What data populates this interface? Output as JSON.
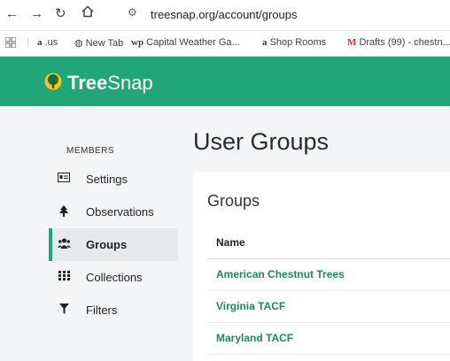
{
  "browser": {
    "url": "treesnap.org/account/groups",
    "bookmarks": [
      {
        "label": ".us",
        "icon": "amazon-icon"
      },
      {
        "label": "New Tab",
        "icon": "globe-icon"
      },
      {
        "label": "Capital Weather Ga...",
        "icon": "washington-post-icon"
      },
      {
        "label": "Shop Rooms",
        "icon": "amazon-icon"
      },
      {
        "label": "Drafts (99) - chestn...",
        "icon": "gmail-icon"
      }
    ]
  },
  "app": {
    "logo_bold": "Tree",
    "logo_light": "Snap",
    "brand_color": "#21a67a"
  },
  "sidebar": {
    "title": "MEMBERS",
    "items": [
      {
        "label": "Settings",
        "icon": "id-card-icon",
        "active": false
      },
      {
        "label": "Observations",
        "icon": "tree-icon",
        "active": false
      },
      {
        "label": "Groups",
        "icon": "users-icon",
        "active": true
      },
      {
        "label": "Collections",
        "icon": "grid-icon",
        "active": false
      },
      {
        "label": "Filters",
        "icon": "filter-icon",
        "active": false
      }
    ]
  },
  "main": {
    "page_title": "User Groups",
    "panel_title": "Groups",
    "column_header": "Name",
    "groups": [
      "American Chestnut Trees",
      "Virginia TACF",
      "Maryland TACF"
    ]
  }
}
